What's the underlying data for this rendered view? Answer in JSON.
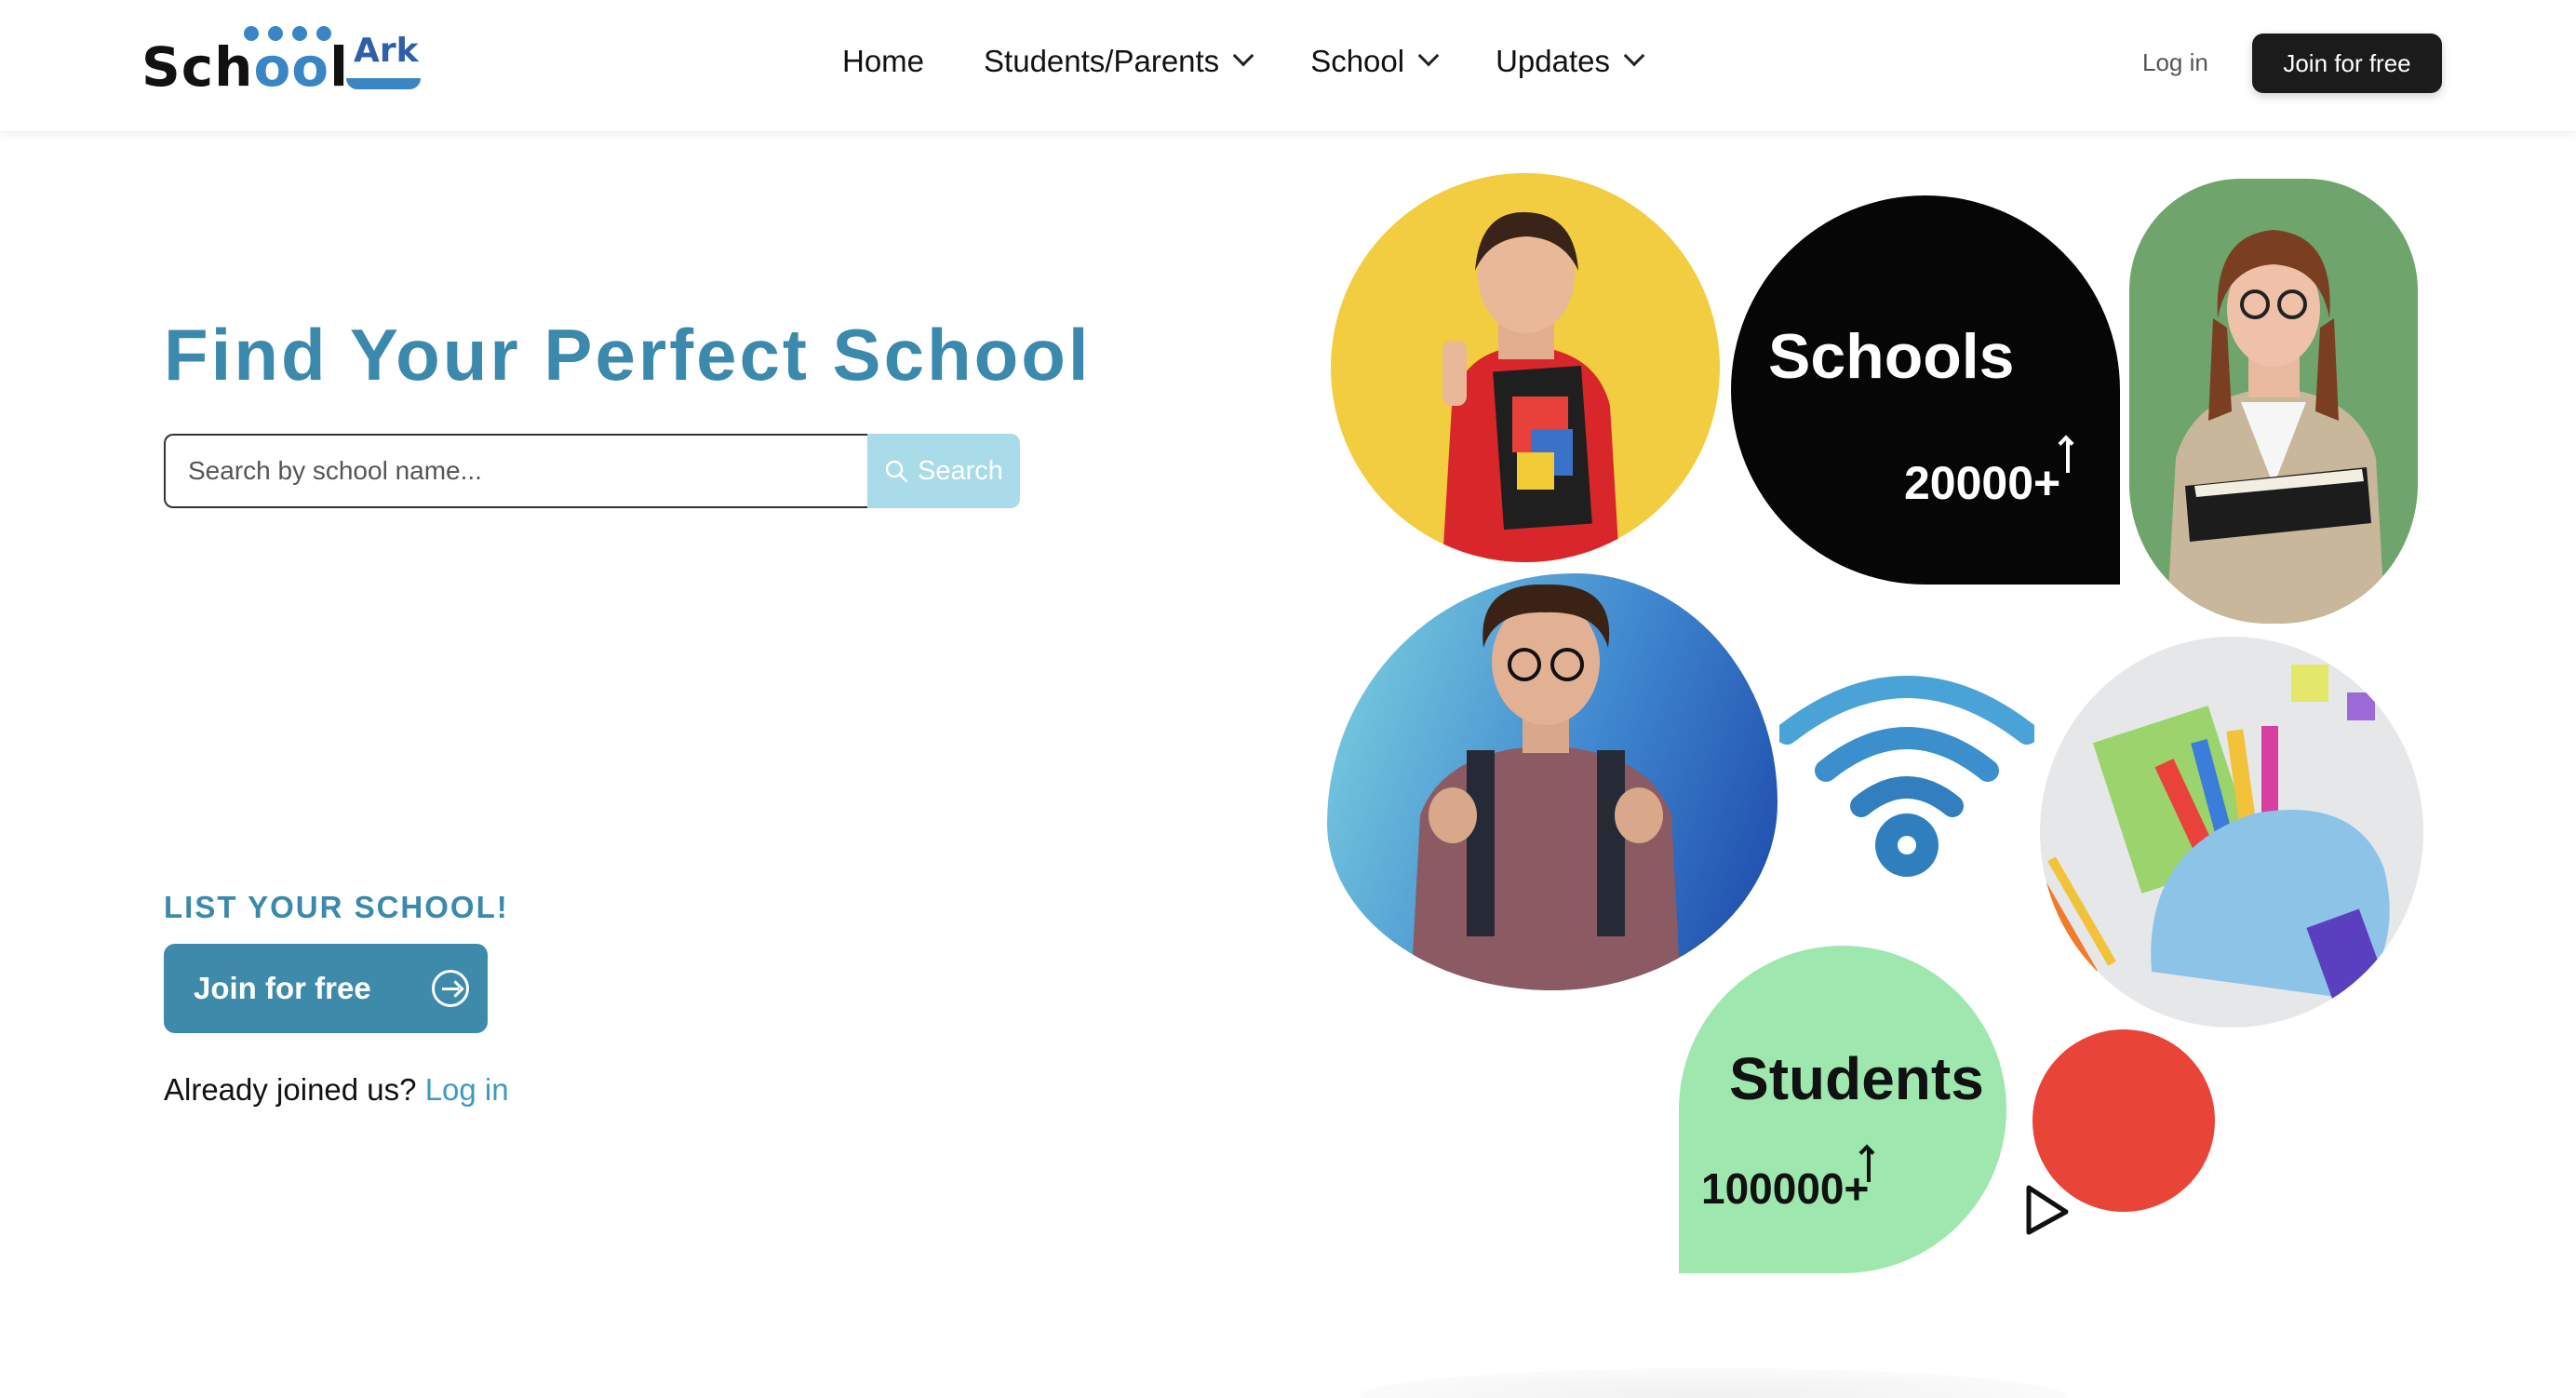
{
  "header": {
    "logo_text_main": "Sch",
    "logo_text_oo": "oo",
    "logo_text_end": "l",
    "logo_ark": "Ark",
    "nav": [
      {
        "label": "Home",
        "has_dropdown": false
      },
      {
        "label": "Students/Parents",
        "has_dropdown": true
      },
      {
        "label": "School",
        "has_dropdown": true
      },
      {
        "label": "Updates",
        "has_dropdown": true
      }
    ],
    "login_label": "Log in",
    "join_label": "Join for free"
  },
  "hero": {
    "title": "Find Your Perfect School",
    "search_placeholder": "Search by school name...",
    "search_button": "Search",
    "list_label": "LIST YOUR SCHOOL!",
    "join_button": "Join for free",
    "already_text": "Already joined us?",
    "already_link": "Log in"
  },
  "stats": {
    "schools_label": "Schools",
    "schools_count": "20000+",
    "students_label": "Students",
    "students_count": "100000+"
  },
  "colors": {
    "accent": "#3b89ac",
    "yellow": "#f1cd3f",
    "mint": "#9ee8af",
    "red": "#e94438",
    "dark": "#1b1b1b"
  },
  "icons": [
    "search-icon",
    "chevron-down-icon",
    "arrow-right-circle-icon",
    "wifi-icon",
    "cursor-pointer-icon"
  ]
}
